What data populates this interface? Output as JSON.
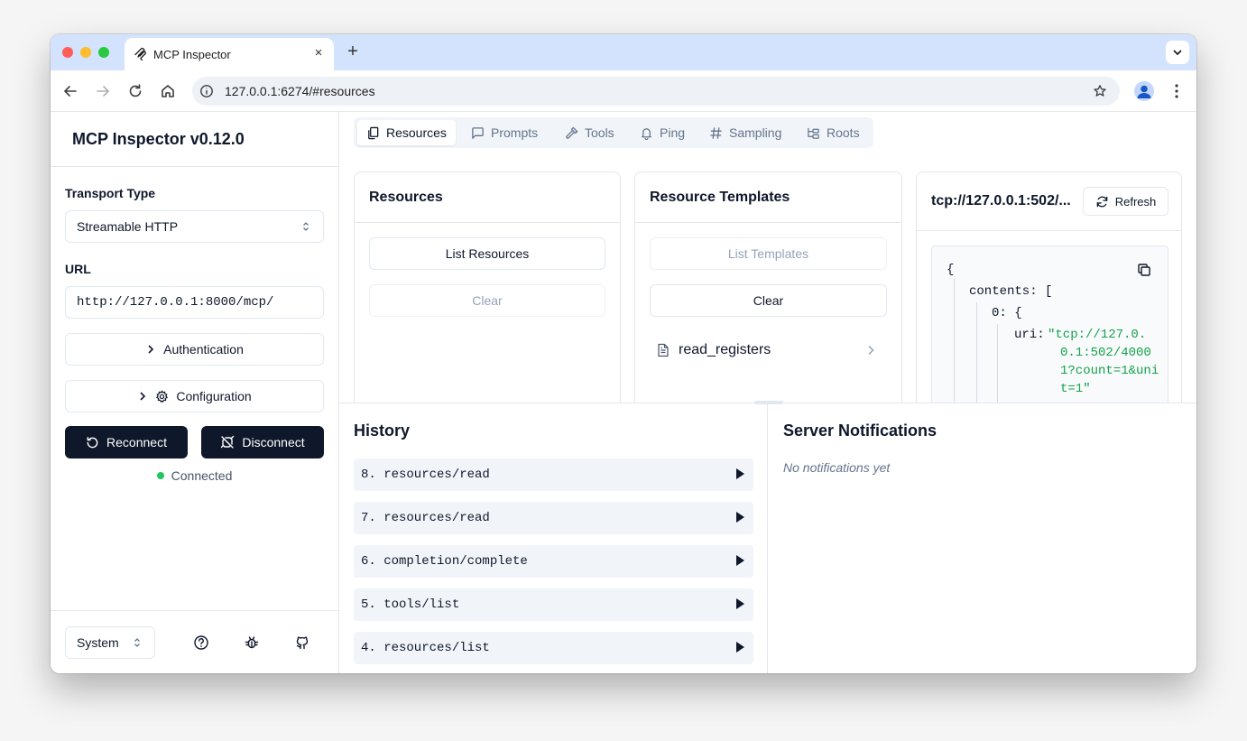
{
  "browser": {
    "tab_title": "MCP Inspector",
    "url": "127.0.0.1:6274/#resources",
    "new_tab": "+",
    "close": "×"
  },
  "sidebar": {
    "title": "MCP Inspector v0.12.0",
    "transport_label": "Transport Type",
    "transport_value": "Streamable HTTP",
    "url_label": "URL",
    "url_value": "http://127.0.0.1:8000/mcp/",
    "authentication": "Authentication",
    "configuration": "Configuration",
    "reconnect": "Reconnect",
    "disconnect": "Disconnect",
    "status": "Connected",
    "theme": "System"
  },
  "tabs": [
    {
      "label": "Resources",
      "icon": "files-icon",
      "active": true
    },
    {
      "label": "Prompts",
      "icon": "message-square-icon"
    },
    {
      "label": "Tools",
      "icon": "hammer-icon"
    },
    {
      "label": "Ping",
      "icon": "bell-icon"
    },
    {
      "label": "Sampling",
      "icon": "hash-icon"
    },
    {
      "label": "Roots",
      "icon": "folder-tree-icon"
    }
  ],
  "resources": {
    "title": "Resources",
    "list_button": "List Resources",
    "clear_button": "Clear"
  },
  "templates": {
    "title": "Resource Templates",
    "list_button": "List Templates",
    "clear_button": "Clear",
    "items": [
      "read_registers"
    ]
  },
  "detail": {
    "title": "tcp://127.0.0.1:502/...",
    "refresh": "Refresh",
    "json": {
      "open_brace": "{",
      "contents_key": "contents:",
      "contents_bracket": "[",
      "index_key": "0:",
      "index_brace": "{",
      "uri_key": "uri:",
      "uri_lines": [
        "\"tcp://127.0.",
        "0.1:502/4000",
        "1?count=1&uni",
        "t=1\""
      ]
    }
  },
  "history": {
    "title": "History",
    "items": [
      "8. resources/read",
      "7. resources/read",
      "6. completion/complete",
      "5. tools/list",
      "4. resources/list"
    ]
  },
  "notifications": {
    "title": "Server Notifications",
    "empty": "No notifications yet"
  }
}
